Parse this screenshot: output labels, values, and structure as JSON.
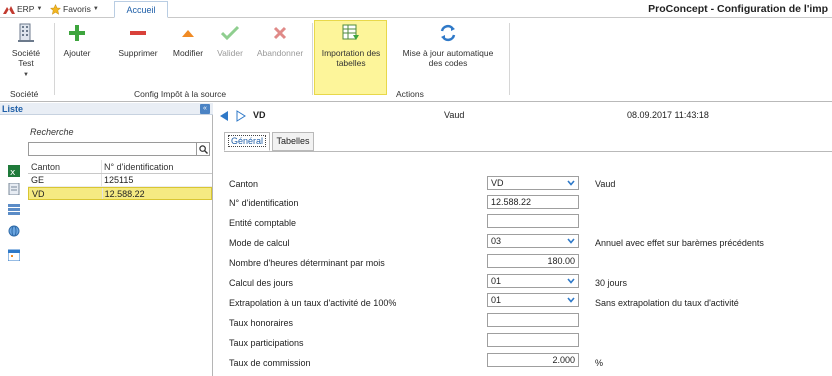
{
  "topbar": {
    "erp_label": "ERP",
    "favoris_label": "Favoris",
    "tab_accueil": "Accueil",
    "app_title": "ProConcept - Configuration de l'imp"
  },
  "ribbon": {
    "societe_button": "Société Test",
    "ajouter": "Ajouter",
    "supprimer": "Supprimer",
    "modifier": "Modifier",
    "valider": "Valider",
    "abandonner": "Abandonner",
    "importation_line1": "Importation des",
    "importation_line2": "tabelles",
    "mise_line1": "Mise à jour automatique",
    "mise_line2": "des codes",
    "group_societe": "Société",
    "group_config": "Config Impôt à la source",
    "group_actions": "Actions"
  },
  "left_panel": {
    "header": "Liste",
    "search_label": "Recherche",
    "search_value": "",
    "columns": [
      "Canton",
      "N° d'identification"
    ],
    "rows": [
      {
        "canton": "GE",
        "id": "125115",
        "selected": false
      },
      {
        "canton": "VD",
        "id": "12.588.22",
        "selected": true
      }
    ]
  },
  "record": {
    "code": "VD",
    "name": "Vaud",
    "date": "08.09.2017 11:43:18"
  },
  "tabs": [
    "Général",
    "Tabelles"
  ],
  "form": {
    "canton_label": "Canton",
    "canton_value": "VD",
    "canton_desc": "Vaud",
    "id_label": "N° d'identification",
    "id_value": "12.588.22",
    "entite_label": "Entité comptable",
    "entite_value": "",
    "mode_label": "Mode de calcul",
    "mode_value": "03",
    "mode_desc": "Annuel avec effet sur barèmes précédents",
    "heures_label": "Nombre d'heures déterminant par mois",
    "heures_value": "180.00",
    "jours_label": "Calcul des jours",
    "jours_value": "01",
    "jours_desc": "30 jours",
    "extrap_label": "Extrapolation à un taux d'activité de 100%",
    "extrap_value": "01",
    "extrap_desc": "Sans extrapolation du taux d'activité",
    "honoraires_label": "Taux honoraires",
    "honoraires_value": "",
    "participations_label": "Taux participations",
    "participations_value": "",
    "commission_label": "Taux de commission",
    "commission_value": "2.000",
    "commission_unit": "%"
  },
  "colors": {
    "accent_blue": "#1f5fa8",
    "highlight_yellow": "#fdf59a",
    "selected_row": "#f5ea82",
    "add_green": "#3ea53e",
    "delete_red": "#d9413a",
    "modify_orange": "#f08a24"
  }
}
